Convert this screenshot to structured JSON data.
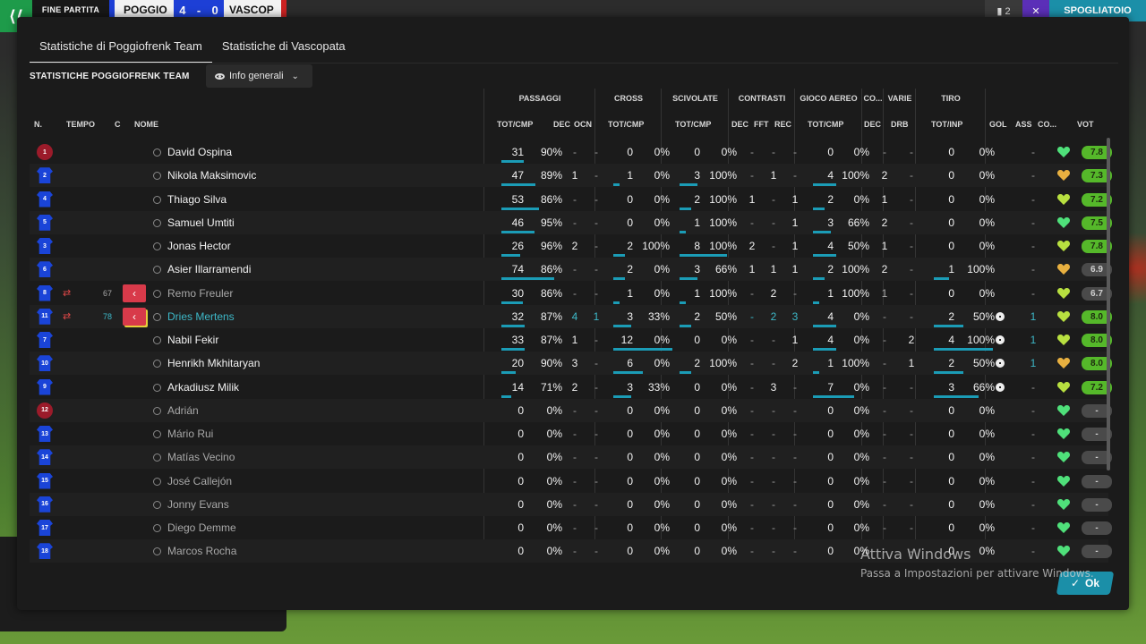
{
  "topbar": {
    "status": "FINE PARTITA",
    "home": "POGGIO",
    "score_home": "4",
    "score_sep": "-",
    "score_away": "0",
    "away": "VASCOP",
    "btn1": "▮ 2",
    "btn2": "✕",
    "btn3": "SPOGLIATOIO"
  },
  "tabs": [
    "Statistiche di Poggiofrenk Team",
    "Statistiche di Vascopata"
  ],
  "section_title": "STATISTICHE POGGIOFRENK TEAM",
  "view_dropdown": "Info generali",
  "groups": [
    "PASSAGGI",
    "CROSS",
    "SCIVOLATE",
    "CONTRASTI",
    "GIOCO AEREO",
    "CO...",
    "VARIE",
    "TIRO"
  ],
  "headers": {
    "num": "N.",
    "time": "TEMPO",
    "c": "C",
    "name": "NOME",
    "pass_tot": "TOT/CMP",
    "pass_dec": "DEC",
    "pass_ocn": "OCN",
    "cross_tot": "TOT/CMP",
    "tack_tot": "TOT/CMP",
    "con_dec": "DEC",
    "con_fft": "FFT",
    "con_rec": "REC",
    "air_tot": "TOT/CMP",
    "co_dec": "DEC",
    "var_drb": "DRB",
    "shot_tot": "TOT/INP",
    "gol": "GOL",
    "ass": "ASS",
    "cond": "CO...",
    "vote": "VOT"
  },
  "players": [
    {
      "num": "1",
      "gk": true,
      "name": "David Ospina",
      "style": "n",
      "sub": "",
      "time": "",
      "pass": "31",
      "pass_pct": "90%",
      "pass_frac": 0.31,
      "dec": "-",
      "ocn": "-",
      "cross": "0",
      "cross_pct": "0%",
      "cross_frac": 0,
      "tack": "0",
      "tack_pct": "0%",
      "tack_frac": 0,
      "con_dec": "-",
      "con_fft": "-",
      "con_rec": "-",
      "air": "0",
      "air_pct": "0%",
      "air_frac": 0,
      "co_dec": "-",
      "drb": "-",
      "shot": "0",
      "shot_pct": "0%",
      "shot_frac": 0,
      "gol": "",
      "ass": "-",
      "heart": "#4fe07a",
      "vote": "7.8",
      "vote_g": true
    },
    {
      "num": "2",
      "gk": false,
      "name": "Nikola Maksimovic",
      "style": "n",
      "sub": "",
      "time": "",
      "pass": "47",
      "pass_pct": "89%",
      "pass_frac": 0.47,
      "dec": "1",
      "ocn": "-",
      "cross": "1",
      "cross_pct": "0%",
      "cross_frac": 0.1,
      "tack": "3",
      "tack_pct": "100%",
      "tack_frac": 0.3,
      "con_dec": "-",
      "con_fft": "1",
      "con_rec": "-",
      "air": "4",
      "air_pct": "100%",
      "air_frac": 0.4,
      "co_dec": "2",
      "drb": "-",
      "shot": "0",
      "shot_pct": "0%",
      "shot_frac": 0,
      "gol": "",
      "ass": "-",
      "heart": "#e8b040",
      "vote": "7.3",
      "vote_g": true
    },
    {
      "num": "4",
      "gk": false,
      "name": "Thiago Silva",
      "style": "n",
      "sub": "",
      "time": "",
      "pass": "53",
      "pass_pct": "86%",
      "pass_frac": 0.53,
      "dec": "-",
      "ocn": "-",
      "cross": "0",
      "cross_pct": "0%",
      "cross_frac": 0,
      "tack": "2",
      "tack_pct": "100%",
      "tack_frac": 0.2,
      "con_dec": "1",
      "con_fft": "-",
      "con_rec": "1",
      "air": "2",
      "air_pct": "0%",
      "air_frac": 0.2,
      "co_dec": "1",
      "drb": "-",
      "shot": "0",
      "shot_pct": "0%",
      "shot_frac": 0,
      "gol": "",
      "ass": "-",
      "heart": "#b8e040",
      "vote": "7.2",
      "vote_g": true
    },
    {
      "num": "5",
      "gk": false,
      "name": "Samuel Umtiti",
      "style": "n",
      "sub": "",
      "time": "",
      "pass": "46",
      "pass_pct": "95%",
      "pass_frac": 0.46,
      "dec": "-",
      "ocn": "-",
      "cross": "0",
      "cross_pct": "0%",
      "cross_frac": 0,
      "tack": "1",
      "tack_pct": "100%",
      "tack_frac": 0.1,
      "con_dec": "-",
      "con_fft": "-",
      "con_rec": "1",
      "air": "3",
      "air_pct": "66%",
      "air_frac": 0.3,
      "co_dec": "2",
      "drb": "-",
      "shot": "0",
      "shot_pct": "0%",
      "shot_frac": 0,
      "gol": "",
      "ass": "-",
      "heart": "#4fe07a",
      "vote": "7.5",
      "vote_g": true
    },
    {
      "num": "3",
      "gk": false,
      "name": "Jonas Hector",
      "style": "n",
      "sub": "",
      "time": "",
      "pass": "26",
      "pass_pct": "96%",
      "pass_frac": 0.26,
      "dec": "2",
      "ocn": "-",
      "cross": "2",
      "cross_pct": "100%",
      "cross_frac": 0.2,
      "tack": "8",
      "tack_pct": "100%",
      "tack_frac": 0.8,
      "con_dec": "2",
      "con_fft": "-",
      "con_rec": "1",
      "air": "4",
      "air_pct": "50%",
      "air_frac": 0.4,
      "co_dec": "1",
      "drb": "-",
      "shot": "0",
      "shot_pct": "0%",
      "shot_frac": 0,
      "gol": "",
      "ass": "-",
      "heart": "#b8e040",
      "vote": "7.8",
      "vote_g": true
    },
    {
      "num": "6",
      "gk": false,
      "name": "Asier Illarramendi",
      "style": "n",
      "sub": "",
      "time": "",
      "pass": "74",
      "pass_pct": "86%",
      "pass_frac": 0.74,
      "dec": "-",
      "ocn": "-",
      "cross": "2",
      "cross_pct": "0%",
      "cross_frac": 0.2,
      "tack": "3",
      "tack_pct": "66%",
      "tack_frac": 0.3,
      "con_dec": "1",
      "con_fft": "1",
      "con_rec": "1",
      "air": "2",
      "air_pct": "100%",
      "air_frac": 0.2,
      "co_dec": "2",
      "drb": "-",
      "shot": "1",
      "shot_pct": "100%",
      "shot_frac": 0.25,
      "gol": "",
      "ass": "-",
      "heart": "#e8b040",
      "vote": "6.9",
      "vote_g": false
    },
    {
      "num": "8",
      "gk": false,
      "name": "Remo Freuler",
      "style": "d",
      "sub": "out",
      "time": "67",
      "pass": "30",
      "pass_pct": "86%",
      "pass_frac": 0.3,
      "dec": "-",
      "ocn": "-",
      "cross": "1",
      "cross_pct": "0%",
      "cross_frac": 0.1,
      "tack": "1",
      "tack_pct": "100%",
      "tack_frac": 0.1,
      "con_dec": "-",
      "con_fft": "2",
      "con_rec": "-",
      "air": "1",
      "air_pct": "100%",
      "air_frac": 0.1,
      "co_dec": "1",
      "drb": "-",
      "shot": "0",
      "shot_pct": "0%",
      "shot_frac": 0,
      "gol": "",
      "ass": "-",
      "heart": "#b8e040",
      "vote": "6.7",
      "vote_g": false
    },
    {
      "num": "11",
      "gk": false,
      "name": "Dries Mertens",
      "style": "t",
      "sub": "in",
      "time": "78",
      "pass": "32",
      "pass_pct": "87%",
      "pass_frac": 0.32,
      "dec": "4",
      "ocn": "1",
      "cross": "3",
      "cross_pct": "33%",
      "cross_frac": 0.3,
      "tack": "2",
      "tack_pct": "50%",
      "tack_frac": 0.2,
      "con_dec": "-",
      "con_fft": "2",
      "con_rec": "3",
      "air": "4",
      "air_pct": "0%",
      "air_frac": 0.4,
      "co_dec": "-",
      "drb": "-",
      "shot": "2",
      "shot_pct": "50%",
      "shot_frac": 0.5,
      "gol": "ball",
      "ass": "1",
      "heart": "#b8e040",
      "vote": "8.0",
      "vote_g": true
    },
    {
      "num": "7",
      "gk": false,
      "name": "Nabil Fekir",
      "style": "n",
      "sub": "",
      "time": "",
      "pass": "33",
      "pass_pct": "87%",
      "pass_frac": 0.33,
      "dec": "1",
      "ocn": "-",
      "cross": "12",
      "cross_pct": "0%",
      "cross_frac": 1.0,
      "tack": "0",
      "tack_pct": "0%",
      "tack_frac": 0,
      "con_dec": "-",
      "con_fft": "-",
      "con_rec": "1",
      "air": "4",
      "air_pct": "0%",
      "air_frac": 0.4,
      "co_dec": "-",
      "drb": "2",
      "shot": "4",
      "shot_pct": "100%",
      "shot_frac": 1.0,
      "gol": "ball",
      "ass": "1",
      "heart": "#b8e040",
      "vote": "8.0",
      "vote_g": true
    },
    {
      "num": "10",
      "gk": false,
      "name": "Henrikh Mkhitaryan",
      "style": "n",
      "sub": "",
      "time": "",
      "pass": "20",
      "pass_pct": "90%",
      "pass_frac": 0.2,
      "dec": "3",
      "ocn": "-",
      "cross": "6",
      "cross_pct": "0%",
      "cross_frac": 0.5,
      "tack": "2",
      "tack_pct": "100%",
      "tack_frac": 0.2,
      "con_dec": "-",
      "con_fft": "-",
      "con_rec": "2",
      "air": "1",
      "air_pct": "100%",
      "air_frac": 0.1,
      "co_dec": "-",
      "drb": "1",
      "shot": "2",
      "shot_pct": "50%",
      "shot_frac": 0.5,
      "gol": "ball",
      "ass": "1",
      "heart": "#e8b040",
      "vote": "8.0",
      "vote_g": true
    },
    {
      "num": "9",
      "gk": false,
      "name": "Arkadiusz Milik",
      "style": "n",
      "sub": "",
      "time": "",
      "pass": "14",
      "pass_pct": "71%",
      "pass_frac": 0.14,
      "dec": "2",
      "ocn": "-",
      "cross": "3",
      "cross_pct": "33%",
      "cross_frac": 0.3,
      "tack": "0",
      "tack_pct": "0%",
      "tack_frac": 0,
      "con_dec": "-",
      "con_fft": "3",
      "con_rec": "-",
      "air": "7",
      "air_pct": "0%",
      "air_frac": 0.7,
      "co_dec": "-",
      "drb": "-",
      "shot": "3",
      "shot_pct": "66%",
      "shot_frac": 0.75,
      "gol": "ball",
      "ass": "-",
      "heart": "#b8e040",
      "vote": "7.2",
      "vote_g": true
    },
    {
      "num": "12",
      "gk": true,
      "name": "Adrián",
      "style": "d",
      "sub": "",
      "time": "",
      "pass": "0",
      "pass_pct": "0%",
      "pass_frac": 0,
      "dec": "-",
      "ocn": "-",
      "cross": "0",
      "cross_pct": "0%",
      "cross_frac": 0,
      "tack": "0",
      "tack_pct": "0%",
      "tack_frac": 0,
      "con_dec": "-",
      "con_fft": "-",
      "con_rec": "-",
      "air": "0",
      "air_pct": "0%",
      "air_frac": 0,
      "co_dec": "-",
      "drb": "-",
      "shot": "0",
      "shot_pct": "0%",
      "shot_frac": 0,
      "gol": "",
      "ass": "-",
      "heart": "#4fe07a",
      "vote": "-",
      "vote_g": false
    },
    {
      "num": "13",
      "gk": false,
      "name": "Mário Rui",
      "style": "d",
      "sub": "",
      "time": "",
      "pass": "0",
      "pass_pct": "0%",
      "pass_frac": 0,
      "dec": "-",
      "ocn": "-",
      "cross": "0",
      "cross_pct": "0%",
      "cross_frac": 0,
      "tack": "0",
      "tack_pct": "0%",
      "tack_frac": 0,
      "con_dec": "-",
      "con_fft": "-",
      "con_rec": "-",
      "air": "0",
      "air_pct": "0%",
      "air_frac": 0,
      "co_dec": "-",
      "drb": "-",
      "shot": "0",
      "shot_pct": "0%",
      "shot_frac": 0,
      "gol": "",
      "ass": "-",
      "heart": "#4fe07a",
      "vote": "-",
      "vote_g": false
    },
    {
      "num": "14",
      "gk": false,
      "name": "Matías Vecino",
      "style": "d",
      "sub": "",
      "time": "",
      "pass": "0",
      "pass_pct": "0%",
      "pass_frac": 0,
      "dec": "-",
      "ocn": "-",
      "cross": "0",
      "cross_pct": "0%",
      "cross_frac": 0,
      "tack": "0",
      "tack_pct": "0%",
      "tack_frac": 0,
      "con_dec": "-",
      "con_fft": "-",
      "con_rec": "-",
      "air": "0",
      "air_pct": "0%",
      "air_frac": 0,
      "co_dec": "-",
      "drb": "-",
      "shot": "0",
      "shot_pct": "0%",
      "shot_frac": 0,
      "gol": "",
      "ass": "-",
      "heart": "#4fe07a",
      "vote": "-",
      "vote_g": false
    },
    {
      "num": "15",
      "gk": false,
      "name": "José Callejón",
      "style": "d",
      "sub": "",
      "time": "",
      "pass": "0",
      "pass_pct": "0%",
      "pass_frac": 0,
      "dec": "-",
      "ocn": "-",
      "cross": "0",
      "cross_pct": "0%",
      "cross_frac": 0,
      "tack": "0",
      "tack_pct": "0%",
      "tack_frac": 0,
      "con_dec": "-",
      "con_fft": "-",
      "con_rec": "-",
      "air": "0",
      "air_pct": "0%",
      "air_frac": 0,
      "co_dec": "-",
      "drb": "-",
      "shot": "0",
      "shot_pct": "0%",
      "shot_frac": 0,
      "gol": "",
      "ass": "-",
      "heart": "#4fe07a",
      "vote": "-",
      "vote_g": false
    },
    {
      "num": "16",
      "gk": false,
      "name": "Jonny Evans",
      "style": "d",
      "sub": "",
      "time": "",
      "pass": "0",
      "pass_pct": "0%",
      "pass_frac": 0,
      "dec": "-",
      "ocn": "-",
      "cross": "0",
      "cross_pct": "0%",
      "cross_frac": 0,
      "tack": "0",
      "tack_pct": "0%",
      "tack_frac": 0,
      "con_dec": "-",
      "con_fft": "-",
      "con_rec": "-",
      "air": "0",
      "air_pct": "0%",
      "air_frac": 0,
      "co_dec": "-",
      "drb": "-",
      "shot": "0",
      "shot_pct": "0%",
      "shot_frac": 0,
      "gol": "",
      "ass": "-",
      "heart": "#4fe07a",
      "vote": "-",
      "vote_g": false
    },
    {
      "num": "17",
      "gk": false,
      "name": "Diego Demme",
      "style": "d",
      "sub": "",
      "time": "",
      "pass": "0",
      "pass_pct": "0%",
      "pass_frac": 0,
      "dec": "-",
      "ocn": "-",
      "cross": "0",
      "cross_pct": "0%",
      "cross_frac": 0,
      "tack": "0",
      "tack_pct": "0%",
      "tack_frac": 0,
      "con_dec": "-",
      "con_fft": "-",
      "con_rec": "-",
      "air": "0",
      "air_pct": "0%",
      "air_frac": 0,
      "co_dec": "-",
      "drb": "-",
      "shot": "0",
      "shot_pct": "0%",
      "shot_frac": 0,
      "gol": "",
      "ass": "-",
      "heart": "#4fe07a",
      "vote": "-",
      "vote_g": false
    },
    {
      "num": "18",
      "gk": false,
      "name": "Marcos Rocha",
      "style": "d",
      "sub": "",
      "time": "",
      "pass": "0",
      "pass_pct": "0%",
      "pass_frac": 0,
      "dec": "-",
      "ocn": "-",
      "cross": "0",
      "cross_pct": "0%",
      "cross_frac": 0,
      "tack": "0",
      "tack_pct": "0%",
      "tack_frac": 0,
      "con_dec": "-",
      "con_fft": "-",
      "con_rec": "-",
      "air": "0",
      "air_pct": "0%",
      "air_frac": 0,
      "co_dec": "-",
      "drb": "-",
      "shot": "0",
      "shot_pct": "0%",
      "shot_frac": 0,
      "gol": "",
      "ass": "-",
      "heart": "#4fe07a",
      "vote": "-",
      "vote_g": false
    }
  ],
  "ok_label": "Ok",
  "watermark": {
    "title": "Attiva Windows",
    "subtitle": "Passa a Impostazioni per attivare Windows."
  },
  "colors": {
    "accent": "#1b9cb6",
    "rating_green": "#55b82a",
    "sub_red": "#d83a4a",
    "home_blue": "#1a44d8"
  }
}
